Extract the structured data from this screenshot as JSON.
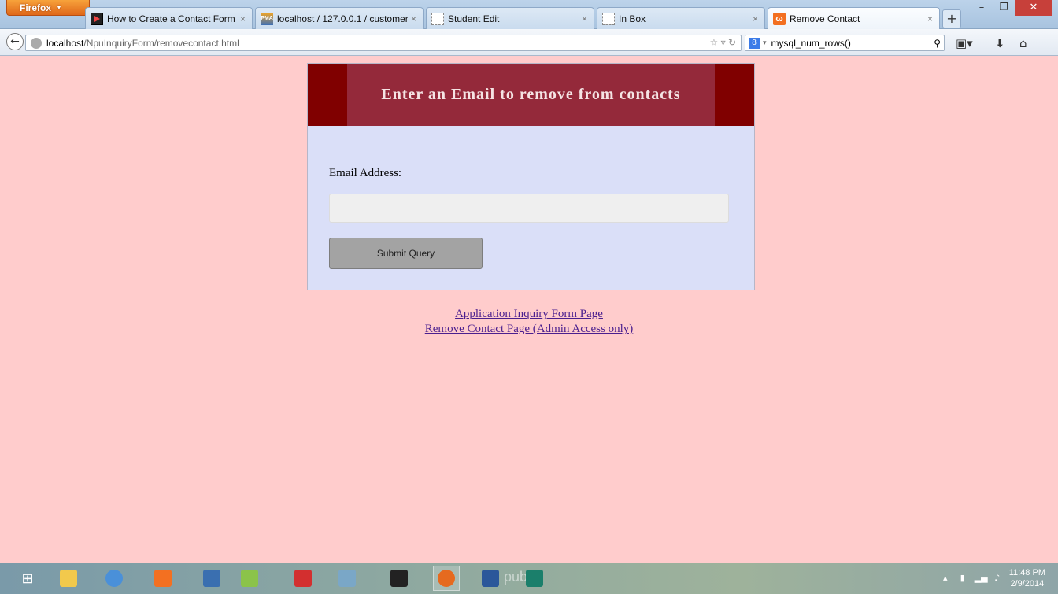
{
  "browser": {
    "menu_button_label": "Firefox",
    "tabs": [
      {
        "title": "How to Create a Contact Form ...",
        "icon": "video-tutorial-icon"
      },
      {
        "title": "localhost / 127.0.0.1 / customer...",
        "icon": "phpmyadmin-icon"
      },
      {
        "title": "Student Edit",
        "icon": "blank-page-icon"
      },
      {
        "title": "In Box",
        "icon": "blank-page-icon"
      },
      {
        "title": "Remove Contact",
        "icon": "xampp-icon",
        "active": true
      }
    ],
    "new_tab_label": "+",
    "url_host": "localhost",
    "url_path": "/NpuInquiryForm/removecontact.html",
    "search_query": "mysql_num_rows()",
    "search_engine_label": "8"
  },
  "page": {
    "header_title": "Enter an Email to remove from contacts",
    "email_label": "Email Address:",
    "email_value": "",
    "email_placeholder": "",
    "submit_label": "Submit Query",
    "links": [
      "Application Inquiry Form Page",
      "Remove Contact Page (Admin Access only)"
    ],
    "colors": {
      "page_background": "#ffcccc",
      "header_outer": "#800000",
      "header_inner": "#94293a",
      "form_background": "#dadff8",
      "submit_button": "#a3a3a3"
    }
  },
  "taskbar": {
    "watermark": "publi",
    "clock_time": "11:48 PM",
    "clock_date": "2/9/2014",
    "apps": [
      "windows-start-icon",
      "file-explorer-icon",
      "chrome-icon",
      "xampp-icon",
      "virtualbox-icon",
      "android-studio-icon",
      "acrobat-icon",
      "access-icon",
      "command-prompt-icon",
      "firefox-icon",
      "word-icon",
      "publisher-icon"
    ]
  }
}
